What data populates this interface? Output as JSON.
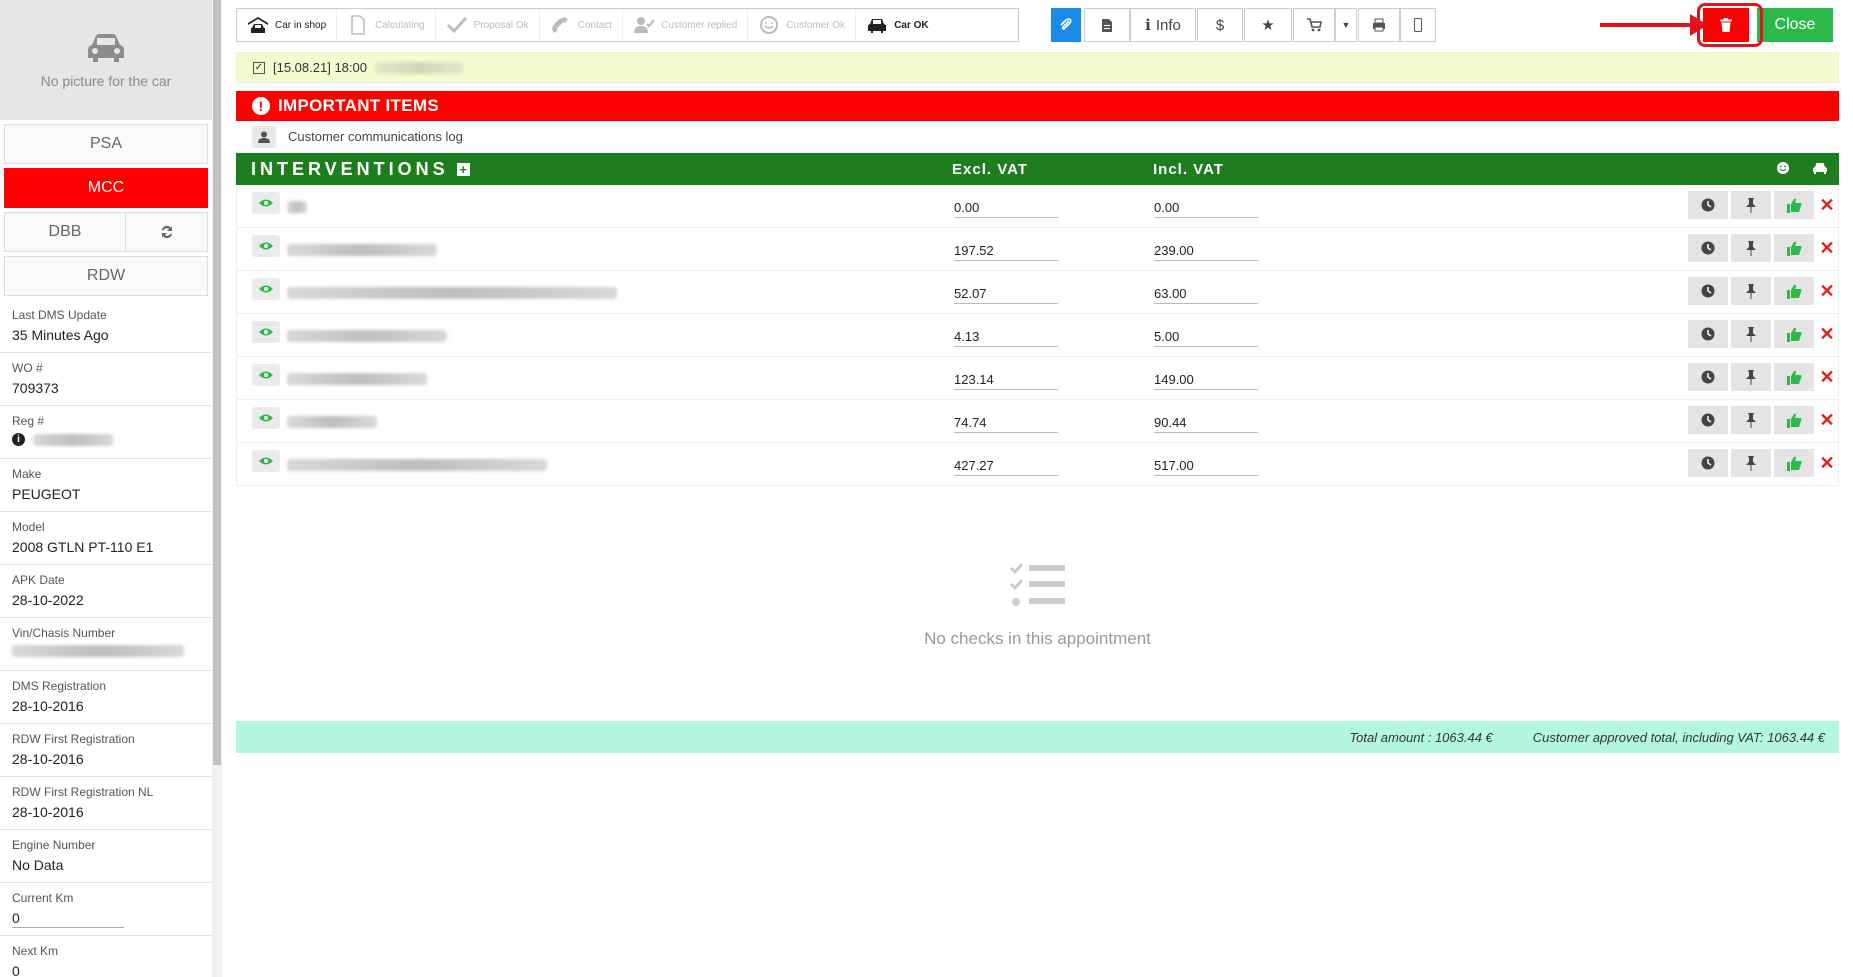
{
  "sidebar": {
    "no_picture": "No picture for the car",
    "brands": [
      "PSA",
      "MCC",
      "DBB",
      "RDW"
    ],
    "active_brand": "MCC",
    "info": [
      {
        "label": "Last DMS Update",
        "value": "35 Minutes Ago"
      },
      {
        "label": "WO #",
        "value": "709373"
      },
      {
        "label": "Reg #",
        "value": ""
      },
      {
        "label": "Make",
        "value": "PEUGEOT"
      },
      {
        "label": "Model",
        "value": "2008 GTLN PT-110 E1"
      },
      {
        "label": "APK Date",
        "value": "28-10-2022"
      },
      {
        "label": "Vin/Chasis Number",
        "value": ""
      },
      {
        "label": "DMS Registration",
        "value": "28-10-2016"
      },
      {
        "label": "RDW First Registration",
        "value": "28-10-2016"
      },
      {
        "label": "RDW First Registration NL",
        "value": "28-10-2016"
      },
      {
        "label": "Engine Number",
        "value": "No Data"
      },
      {
        "label": "Current Km",
        "value": "0"
      },
      {
        "label": "Next Km",
        "value": "0"
      }
    ]
  },
  "steps": [
    {
      "label": "Car in shop",
      "icon": "car-in-shop-icon",
      "done": true
    },
    {
      "label": "Calculating",
      "icon": "document-icon",
      "done": false
    },
    {
      "label": "Proposal Ok",
      "icon": "check-icon",
      "done": false
    },
    {
      "label": "Contact",
      "icon": "phone-icon",
      "done": false
    },
    {
      "label": "Customer replied",
      "icon": "user-check-icon",
      "done": false
    },
    {
      "label": "Customer Ok",
      "icon": "smile-icon",
      "done": false
    },
    {
      "label": "Car OK",
      "icon": "car-icon",
      "done": true
    }
  ],
  "toolbar": {
    "info_label": "Info",
    "dollar_label": "$",
    "close_label": "Close"
  },
  "appointment": {
    "text": "[15.08.21] 18:00"
  },
  "important": {
    "title": "IMPORTANT ITEMS",
    "log_label": "Customer communications log"
  },
  "interventions": {
    "title": "INTERVENTIONS",
    "excl_header": "Excl. VAT",
    "incl_header": "Incl. VAT",
    "rows": [
      {
        "excl": "0.00",
        "incl": "0.00"
      },
      {
        "excl": "197.52",
        "incl": "239.00"
      },
      {
        "excl": "52.07",
        "incl": "63.00"
      },
      {
        "excl": "4.13",
        "incl": "5.00"
      },
      {
        "excl": "123.14",
        "incl": "149.00"
      },
      {
        "excl": "74.74",
        "incl": "90.44"
      },
      {
        "excl": "427.27",
        "incl": "517.00"
      }
    ]
  },
  "checks": {
    "empty_text": "No checks in this appointment"
  },
  "totals": {
    "total_amount": "Total amount : 1063.44 €",
    "approved_total": "Customer approved total, including VAT: 1063.44 €"
  },
  "colors": {
    "accent_red": "#ff0000",
    "green": "#1e7d1e",
    "blue": "#1a8be8",
    "close_green": "#2cb84b",
    "totals_bg": "#b3f7e1"
  }
}
